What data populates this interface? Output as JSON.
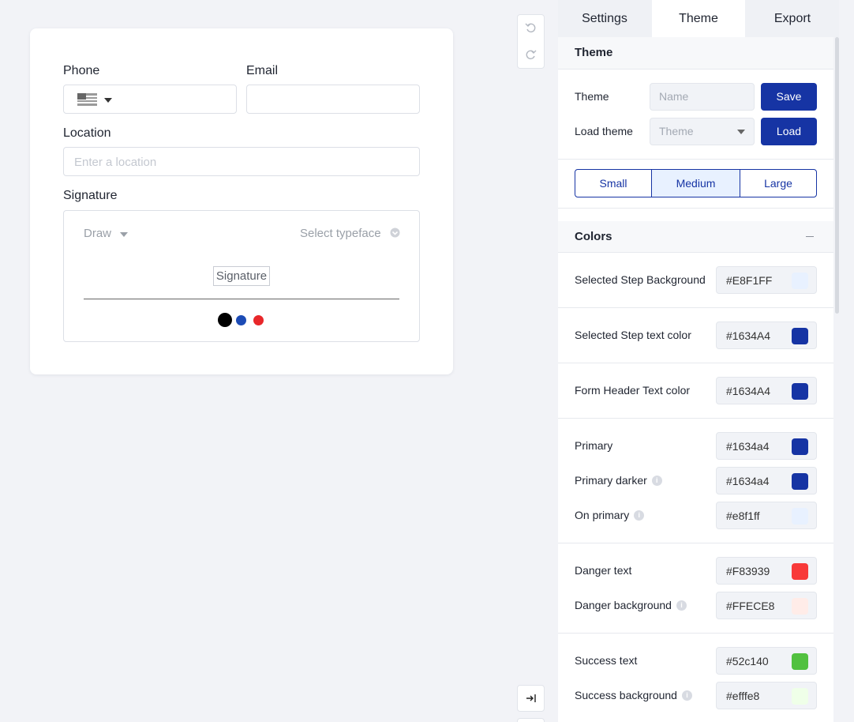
{
  "form": {
    "phone_label": "Phone",
    "email_label": "Email",
    "location_label": "Location",
    "location_placeholder": "Enter a location",
    "signature_label": "Signature",
    "signature_mode": "Draw",
    "signature_typeface": "Select typeface",
    "signature_field": "Signature",
    "pen_colors": [
      "#000000",
      "#1c4bb5",
      "#e8272a"
    ]
  },
  "tabs": [
    "Settings",
    "Theme",
    "Export"
  ],
  "active_tab": "Theme",
  "theme_section": {
    "title": "Theme",
    "theme_label": "Theme",
    "name_placeholder": "Name",
    "save_label": "Save",
    "load_label": "Load theme",
    "load_select": "Theme",
    "load_button": "Load"
  },
  "sizes": [
    "Small",
    "Medium",
    "Large"
  ],
  "active_size": "Medium",
  "colors_section": {
    "title": "Colors",
    "items": [
      {
        "label": "Selected Step Background",
        "value": "#E8F1FF",
        "swatch": "#E8F1FF",
        "info": false
      },
      {
        "label": "Selected Step text color",
        "value": "#1634A4",
        "swatch": "#1634A4",
        "info": false
      },
      {
        "label": "Form Header Text color",
        "value": "#1634A4",
        "swatch": "#1634A4",
        "info": false
      },
      {
        "label": "Primary",
        "value": "#1634a4",
        "swatch": "#1634a4",
        "info": false
      },
      {
        "label": "Primary darker",
        "value": "#1634a4",
        "swatch": "#1634a4",
        "info": true
      },
      {
        "label": "On primary",
        "value": "#e8f1ff",
        "swatch": "#e8f1ff",
        "info": true
      },
      {
        "label": "Danger text",
        "value": "#F83939",
        "swatch": "#F83939",
        "info": false
      },
      {
        "label": "Danger background",
        "value": "#FFECE8",
        "swatch": "#FFECE8",
        "info": true
      },
      {
        "label": "Success text",
        "value": "#52c140",
        "swatch": "#52c140",
        "info": false
      },
      {
        "label": "Success background",
        "value": "#efffe8",
        "swatch": "#efffe8",
        "info": true
      }
    ]
  },
  "icons": {
    "undo": "undo-icon",
    "redo": "redo-icon",
    "collapse": "collapse-right-icon",
    "flag": "us-flag-icon"
  }
}
